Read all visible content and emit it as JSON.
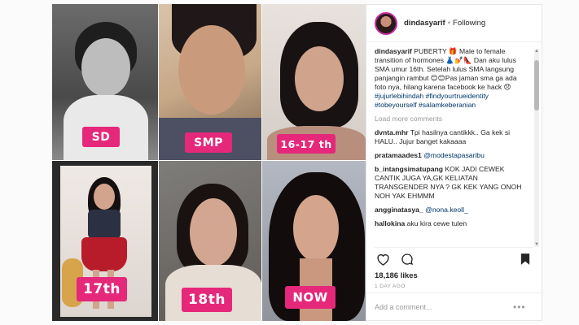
{
  "collage": {
    "labels": [
      "SD",
      "SMP",
      "16-17 th",
      "17th",
      "18th",
      "NOW"
    ]
  },
  "post": {
    "username": "dindasyarif",
    "separator": "•",
    "follow_status": "Following",
    "caption_user": "dindasyarif",
    "caption_text": "PUBERTY 🎁 Male to female transition of hormones 👗💅👠 Dan aku lulus SMA umur 16th. Setelah lulus SMA langsung panjangin rambut 😊😊Pas jaman sma ga ada foto nya, hilang karena facebook ke hack 😞",
    "caption_tags": "#jujurlebihindah #findyourtrueidentity #tobeyourself #salamkeberanian",
    "load_more": "Load more comments",
    "comments": [
      {
        "user": "dvnta.mhr",
        "text": "Tpi hasilnya cantikkk.. Ga kek si HALU.. Jujur banget kakaaaa"
      },
      {
        "user": "pratamaades1",
        "mention": "@modestapasaribu",
        "text": ""
      },
      {
        "user": "b_intangsimatupang",
        "text": "KOK JADI CEWEK CANTIK JUGA YA,GK KELIATAN TRANSGENDER NYA ? GK KEK YANG ONOH NOH YAK EHMMM"
      },
      {
        "user": "angginatasya_",
        "mention": "@nona.keoll_",
        "text": ""
      },
      {
        "user": "hallokina",
        "text": "aku kira cewe tulen"
      }
    ],
    "likes": "18,186 likes",
    "time_ago": "1 DAY AGO",
    "add_comment_placeholder": "Add a comment...",
    "more_options": "•••"
  },
  "colors": {
    "label_pink": "#e5287a",
    "link_blue": "#003569",
    "story_ring": "#c32aa3"
  },
  "icons": [
    "heart-icon",
    "comment-icon",
    "bookmark-icon",
    "avatar"
  ]
}
